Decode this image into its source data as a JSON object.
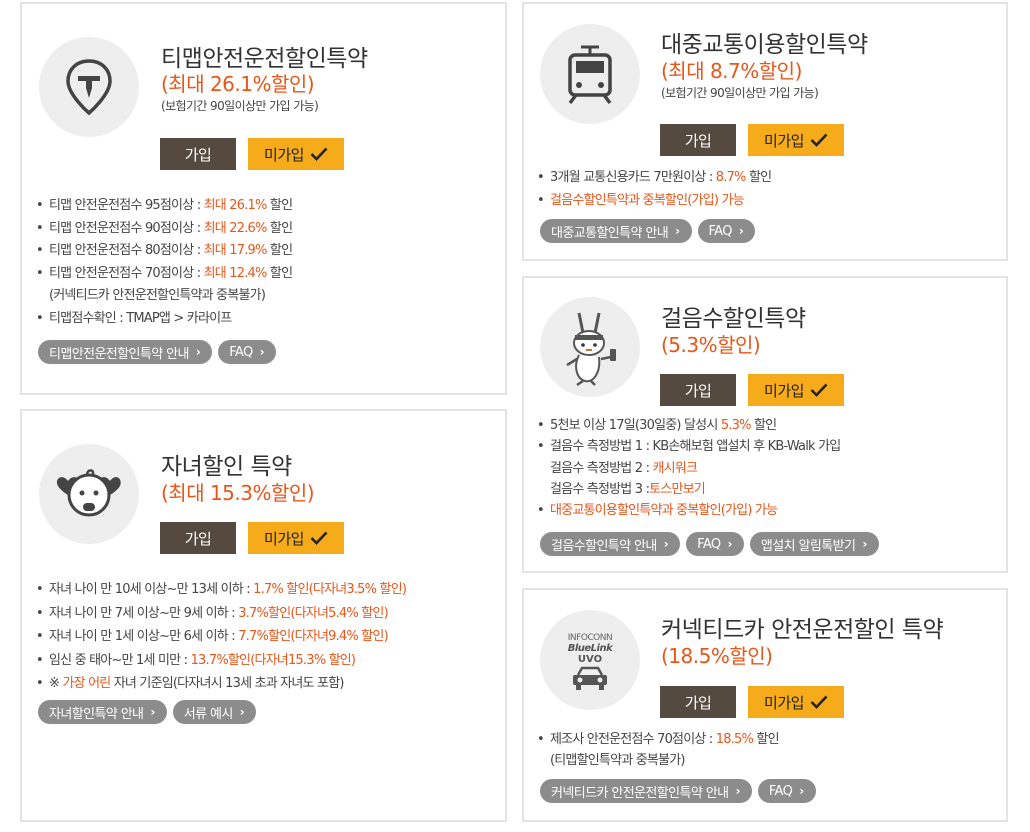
{
  "labels": {
    "join": "가입",
    "not_join": "미가입"
  },
  "tmap": {
    "title": "티맵안전운전할인특약",
    "rate": "(최대 26.1%할인)",
    "note": "(보험기간 90일이상만 가입 가능)",
    "items": [
      {
        "pre": "티맵 안전운전점수 95점이상 : ",
        "hl": "최대 26.1%",
        "post": " 할인"
      },
      {
        "pre": "티맵 안전운전점수 90점이상 : ",
        "hl": "최대 22.6%",
        "post": " 할인"
      },
      {
        "pre": "티맵 안전운전점수 80점이상 : ",
        "hl": "최대 17.9%",
        "post": " 할인"
      },
      {
        "pre": "티맵 안전운전점수 70점이상 : ",
        "hl": "최대 12.4%",
        "post": " 할인"
      },
      {
        "text": "(커넥티드카 안전운전할인특약과 중복불가)"
      },
      {
        "text": "티맵점수확인 : TMAP앱 > 카라이프"
      }
    ],
    "pills": [
      "티맵안전운전할인특약 안내",
      "FAQ"
    ]
  },
  "child": {
    "title": "자녀할인 특약",
    "rate": "(최대 15.3%할인)",
    "items": [
      {
        "pre": "자녀 나이 만 10세 이상~만 13세 이하 : ",
        "hl": "1.7% 할인(다자녀3.5% 할인)"
      },
      {
        "pre": "자녀 나이 만 7세 이상~만 9세 이하 : ",
        "hl": "3.7%할인(다자녀5.4% 할인)"
      },
      {
        "pre": "자녀 나이 만 1세 이상~만 6세 이하 : ",
        "hl": "7.7%할인(다자녀9.4% 할인)"
      },
      {
        "pre": "임신 중 태아~만 1세 미만 : ",
        "hl": "13.7%할인(다자녀15.3% 할인)"
      },
      {
        "pre": "※ ",
        "hl": "가장 어린",
        "post": " 자녀 기준임(다자녀시 13세 초과 자녀도 포함)"
      }
    ],
    "pills": [
      "자녀할인특약 안내",
      "서류 예시"
    ]
  },
  "transit": {
    "title": "대중교통이용할인특약",
    "rate": "(최대 8.7%할인)",
    "note": "(보험기간 90일이상만 가입 가능)",
    "items": [
      {
        "pre": "3개월 교통신용카드 7만원이상 : ",
        "hl": "8.7%",
        "post": " 할인"
      },
      {
        "hl": "걸음수할인특약과 중복할인(가입) 가능"
      }
    ],
    "pills": [
      "대중교통할인특약 안내",
      "FAQ"
    ]
  },
  "walk": {
    "title": "걸음수할인특약",
    "rate": "(5.3%할인)",
    "items": [
      {
        "pre": "5천보 이상 17일(30일중) 달성시 ",
        "hl": "5.3%",
        "post": " 할인"
      },
      {
        "pre": "걸음수 측정방법 1 : KB손해보험 앱설치 후 KB-Walk 가입"
      },
      {
        "pre": "걸음수 측정방법 2 : ",
        "hl": "캐시워크",
        "cont": true
      },
      {
        "pre": "걸음수 측정방법 3 :",
        "hl": "토스만보기",
        "cont": true
      },
      {
        "hl": "대중교통이용할인특약과 중복할인(가입) 가능"
      }
    ],
    "pills": [
      "걸음수할인특약 안내",
      "FAQ",
      "앱설치 알림톡받기"
    ]
  },
  "connected": {
    "title": "커넥티드카 안전운전할인 특약",
    "rate": "(18.5%할인)",
    "logo_lines": [
      "INFOCONN",
      "BlueLink",
      "UVO"
    ],
    "items": [
      {
        "pre": "제조사 안전운전점수 70점이상 : ",
        "hl": "18.5%",
        "post": " 할인"
      },
      {
        "text": "(티맵할인특약과 중복불가)",
        "cont": true
      }
    ],
    "pills": [
      "커넥티드카 안전운전할인특약 안내",
      "FAQ"
    ]
  },
  "colors": {
    "accent": "#e8561a",
    "join_bg": "#544a40",
    "not_join_bg": "#f6ab1a",
    "pill_bg": "#8c8c8c",
    "card_border": "#e3e3e3"
  },
  "icons": {
    "tmap": "tmap-pin-icon",
    "child": "baby-hearts-icon",
    "transit": "train-icon",
    "walk": "rabbit-mascot-icon",
    "connected": "connected-car-logo-icon"
  }
}
